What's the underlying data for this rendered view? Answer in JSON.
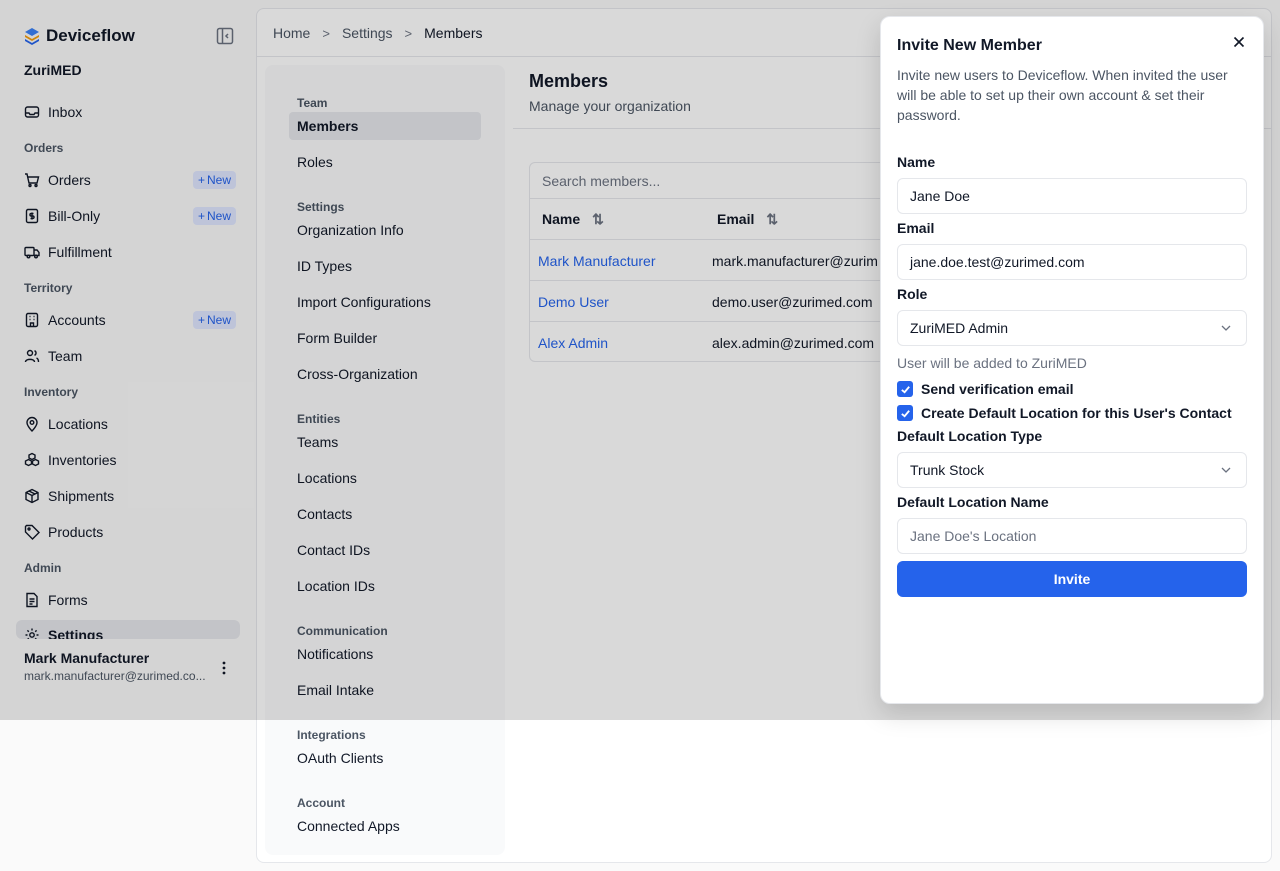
{
  "app": {
    "name": "Deviceflow",
    "org": "ZuriMED"
  },
  "sidebar": {
    "inbox": "Inbox",
    "sections": {
      "orders": "Orders",
      "territory": "Territory",
      "inventory": "Inventory",
      "admin": "Admin"
    },
    "items": {
      "orders": "Orders",
      "bill_only": "Bill-Only",
      "fulfillment": "Fulfillment",
      "accounts": "Accounts",
      "team": "Team",
      "locations": "Locations",
      "inventories": "Inventories",
      "shipments": "Shipments",
      "products": "Products",
      "forms": "Forms",
      "settings": "Settings"
    },
    "new_label": "New",
    "user": {
      "name": "Mark Manufacturer",
      "email": "mark.manufacturer@zurimed.co..."
    }
  },
  "breadcrumb": {
    "home": "Home",
    "settings": "Settings",
    "current": "Members"
  },
  "settings_nav": {
    "sections": {
      "team": "Team",
      "settings": "Settings",
      "entities": "Entities",
      "communication": "Communication",
      "integrations": "Integrations",
      "account": "Account"
    },
    "items": {
      "members": "Members",
      "roles": "Roles",
      "organization_info": "Organization Info",
      "id_types": "ID Types",
      "import_configurations": "Import Configurations",
      "form_builder": "Form Builder",
      "cross_organization": "Cross-Organization",
      "teams": "Teams",
      "locations": "Locations",
      "contacts": "Contacts",
      "contact_ids": "Contact IDs",
      "location_ids": "Location IDs",
      "notifications": "Notifications",
      "email_intake": "Email Intake",
      "oauth_clients": "OAuth Clients",
      "connected_apps": "Connected Apps"
    }
  },
  "page": {
    "title": "Members",
    "subtitle": "Manage your organization"
  },
  "members_table": {
    "search_placeholder": "Search members...",
    "columns": {
      "name": "Name",
      "email": "Email"
    },
    "rows": [
      {
        "name": "Mark Manufacturer",
        "email": "mark.manufacturer@zurim"
      },
      {
        "name": "Demo User",
        "email": "demo.user@zurimed.com"
      },
      {
        "name": "Alex Admin",
        "email": "alex.admin@zurimed.com"
      }
    ]
  },
  "dialog": {
    "title": "Invite New Member",
    "description": "Invite new users to Deviceflow. When invited the user will be able to set up their own account & set their password.",
    "name_label": "Name",
    "name_value": "Jane Doe",
    "email_label": "Email",
    "email_value": "jane.doe.test@zurimed.com",
    "role_label": "Role",
    "role_value": "ZuriMED Admin",
    "helper": "User will be added to ZuriMED",
    "send_verification": {
      "label": "Send verification email",
      "checked": true
    },
    "create_default_location": {
      "label": "Create Default Location for this User's Contact",
      "checked": true
    },
    "location_type_label": "Default Location Type",
    "location_type_value": "Trunk Stock",
    "location_name_label": "Default Location Name",
    "location_name_placeholder": "Jane Doe's Location",
    "invite_label": "Invite"
  },
  "colors": {
    "accent": "#2563eb",
    "badge_bg": "#e0e7ff"
  }
}
